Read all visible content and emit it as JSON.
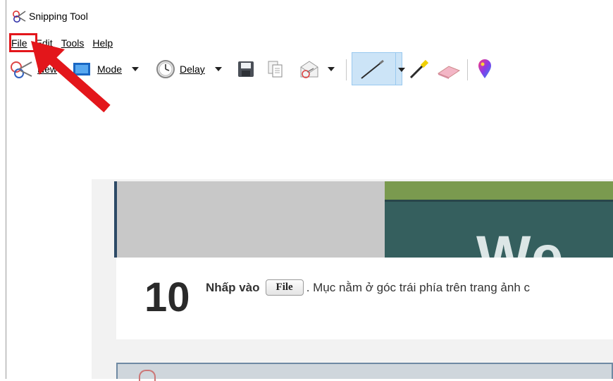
{
  "window": {
    "title": "Snipping Tool"
  },
  "menu": [
    {
      "label": "File"
    },
    {
      "label": "Edit"
    },
    {
      "label": "Tools"
    },
    {
      "label": "Help"
    }
  ],
  "toolbar": {
    "new_label": "New",
    "mode_label": "Mode",
    "delay_label": "Delay"
  },
  "colors": {
    "highlight": "#e3161b",
    "pen_active": "#cce4f7"
  },
  "content": {
    "step_number": "10",
    "step_bold": "Nhấp vào",
    "button_label": "File",
    "step_rest": ". Mục nằm ở góc trái phía trên trang ảnh c",
    "banner_text": "We"
  },
  "annotation": {
    "arrow_target": "File menu"
  }
}
